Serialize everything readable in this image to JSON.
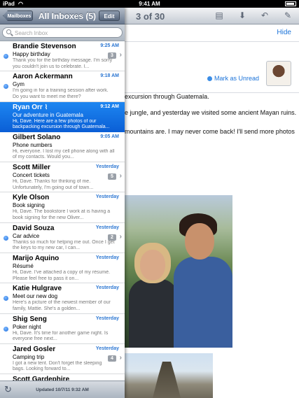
{
  "status_bar": {
    "carrier": "iPad",
    "time": "9:41 AM"
  },
  "sidebar": {
    "back_label": "Mailboxes",
    "title": "All Inboxes (5)",
    "edit_label": "Edit",
    "search_placeholder": "Search Inbox",
    "messages": [
      {
        "sender": "Brandie Stevenson",
        "time": "9:25 AM",
        "subject": "Happy birthday",
        "preview": "Thank you for the birthday message. I'm sorry you couldn't join us to celebrate. I...",
        "unread": true,
        "badge": "3"
      },
      {
        "sender": "Aaron Ackermann",
        "time": "9:18 AM",
        "subject": "Gym",
        "preview": "I'm going in for a training session after work. Do you want to meet me there?",
        "unread": true,
        "badge": ""
      },
      {
        "sender": "Ryan Orr",
        "time": "9:12 AM",
        "subject": "Our adventure in Guatemala",
        "preview": "Hi, Dave. Here are a few photos of our backpacking excursion through Guatemala...",
        "unread": false,
        "badge": "",
        "selected": true,
        "attachment": true
      },
      {
        "sender": "Gilbert Solano",
        "time": "9:05 AM",
        "subject": "Phone numbers",
        "preview": "Hi, everyone. I lost my cell phone along with all of my contacts. Would you...",
        "unread": false,
        "badge": ""
      },
      {
        "sender": "Scott Miller",
        "time": "Yesterday",
        "subject": "Concert tickets",
        "preview": "Hi, Dave. Thanks for thinking of me. Unfortunately, I'm going out of town...",
        "unread": false,
        "badge": "5"
      },
      {
        "sender": "Kyle Olson",
        "time": "Yesterday",
        "subject": "Book signing",
        "preview": "Hi, Dave. The bookstore I work at is having a book signing for the new Oliver...",
        "unread": false,
        "badge": ""
      },
      {
        "sender": "David Souza",
        "time": "Yesterday",
        "subject": "Car advice",
        "preview": "Thanks so much for helping me out. Once I get the keys to my new car, I can...",
        "unread": true,
        "badge": "2"
      },
      {
        "sender": "Marijo Aquino",
        "time": "Yesterday",
        "subject": "Résumé",
        "preview": "Hi, Dave. I've attached a copy of my résumé. Please feel free to pass it on...",
        "unread": false,
        "badge": ""
      },
      {
        "sender": "Katie Hulgrave",
        "time": "Yesterday",
        "subject": "Meet our new dog",
        "preview": "Here's a picture of the newest member of our family, Mattie. She's a golden...",
        "unread": true,
        "badge": ""
      },
      {
        "sender": "Shig Seng",
        "time": "Yesterday",
        "subject": "Poker night",
        "preview": "Hi, Dave. It's time for another game night. Is everyone free next...",
        "unread": true,
        "badge": ""
      },
      {
        "sender": "Jared Gosler",
        "time": "Yesterday",
        "subject": "Camping trip",
        "preview": "I got a new tent. Don't forget the sleeping bags. Looking forward to...",
        "unread": false,
        "badge": "4"
      },
      {
        "sender": "Scott Gardephire",
        "time": "",
        "subject": "",
        "preview": "",
        "unread": false,
        "badge": ""
      }
    ],
    "updated_text": "Updated  10/7/11  9:32 AM"
  },
  "main": {
    "counter": "3 of 30",
    "hide_label": "Hide",
    "mark_unread_label": "Mark as Unread",
    "body_lines": [
      "excursion through Guatemala.",
      "e jungle, and yesterday we visited some ancient Mayan ruins.",
      "mountains are. I may never come back! I'll send more photos"
    ],
    "toolbar_icons": [
      "folder-icon",
      "archive-icon",
      "reply-icon",
      "compose-icon"
    ]
  }
}
